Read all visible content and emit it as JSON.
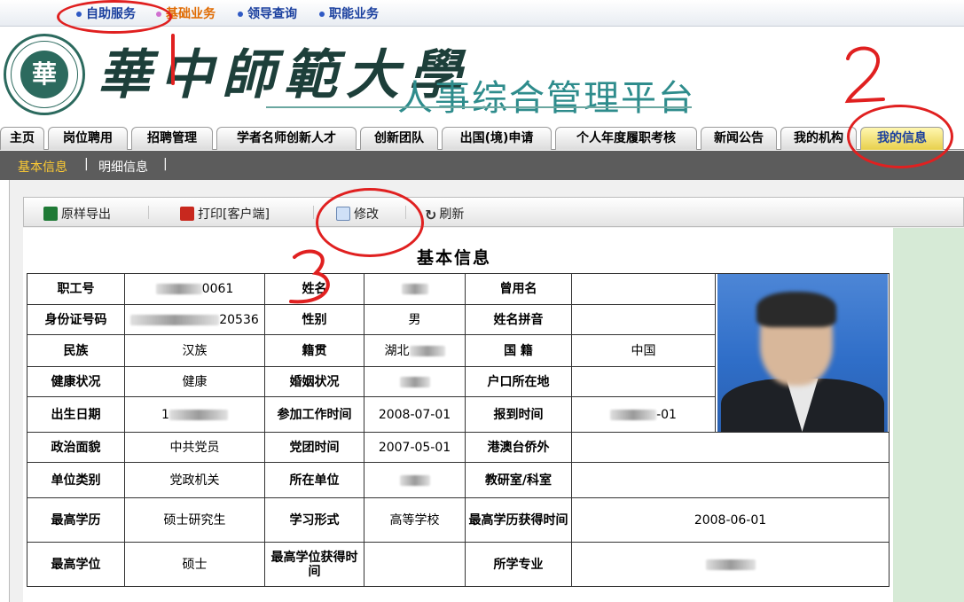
{
  "services": [
    {
      "label": "自助服务",
      "active": false
    },
    {
      "label": "基础业务",
      "active": true
    },
    {
      "label": "领导查询",
      "active": false
    },
    {
      "label": "职能业务",
      "active": false
    }
  ],
  "banner": {
    "seal_glyph": "華",
    "university_name": "華中師範大學",
    "platform_title": "人事综合管理平台"
  },
  "tabs": [
    {
      "label": "主页"
    },
    {
      "label": "岗位聘用"
    },
    {
      "label": "招聘管理"
    },
    {
      "label": "学者名师创新人才"
    },
    {
      "label": "创新团队"
    },
    {
      "label": "出国(境)申请"
    },
    {
      "label": "个人年度履职考核"
    },
    {
      "label": "新闻公告"
    },
    {
      "label": "我的机构"
    },
    {
      "label": "我的信息",
      "active": true
    }
  ],
  "subnav": {
    "items": [
      {
        "label": "基本信息",
        "active": true
      },
      {
        "label": "明细信息",
        "active": false
      }
    ],
    "separator": "|"
  },
  "toolbar": {
    "export_label": "原样导出",
    "print_label": "打印[客户端]",
    "edit_label": "修改",
    "refresh_label": "刷新"
  },
  "form": {
    "title": "基本信息",
    "rows": [
      {
        "l1": "职工号",
        "v1": "0061",
        "l2": "姓名",
        "v2": "",
        "l3": "曾用名",
        "v3": ""
      },
      {
        "l1": "身份证号码",
        "v1": "20536",
        "l2": "性别",
        "v2": "男",
        "l3": "姓名拼音",
        "v3": ""
      },
      {
        "l1": "民族",
        "v1": "汉族",
        "l2": "籍贯",
        "v2": "湖北",
        "l3": "国 籍",
        "v3": "中国"
      },
      {
        "l1": "健康状况",
        "v1": "健康",
        "l2": "婚姻状况",
        "v2": "",
        "l3": "户口所在地",
        "v3": ""
      },
      {
        "l1": "出生日期",
        "v1": "1",
        "l2": "参加工作时间",
        "v2": "2008-07-01",
        "l3": "报到时间",
        "v3": "-01"
      },
      {
        "l1": "政治面貌",
        "v1": "中共党员",
        "l2": "党团时间",
        "v2": "2007-05-01",
        "l3": "港澳台侨外",
        "v3": ""
      },
      {
        "l1": "单位类别",
        "v1": "党政机关",
        "l2": "所在单位",
        "v2": "",
        "l3": "教研室/科室",
        "v3": ""
      },
      {
        "l1": "最高学历",
        "v1": "硕士研究生",
        "l2": "学习形式",
        "v2": "高等学校",
        "l3": "最高学历获得时间",
        "v3": "2008-06-01"
      },
      {
        "l1": "最高学位",
        "v1": "硕士",
        "l2": "最高学位获得时间",
        "v2": "",
        "l3": "所学专业",
        "v3": ""
      }
    ]
  },
  "annotations": {
    "mark_2": "2",
    "mark_3": "3"
  },
  "colors": {
    "annotation_red": "#e02020",
    "subnav_bg": "#5c5c5c",
    "active_tab": "#e8d04c",
    "side_panel": "#d6ead6"
  }
}
